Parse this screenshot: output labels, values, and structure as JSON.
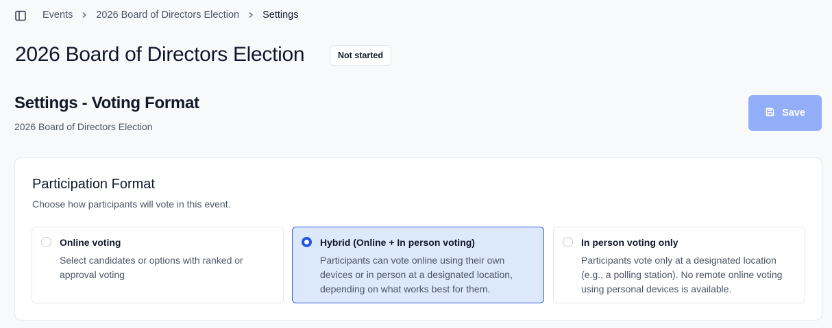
{
  "breadcrumb": {
    "items": [
      "Events",
      "2026 Board of Directors Election"
    ],
    "current": "Settings"
  },
  "page": {
    "title": "2026 Board of Directors Election",
    "status": "Not started"
  },
  "section": {
    "title": "Settings - Voting Format",
    "subtitle": "2026 Board of Directors Election",
    "save_label": "Save"
  },
  "participation": {
    "title": "Participation Format",
    "description": "Choose how participants will vote in this event.",
    "options": [
      {
        "label": "Online voting",
        "description": "Select candidates or options with ranked or approval voting",
        "selected": false
      },
      {
        "label": "Hybrid (Online + In person voting)",
        "description": "Participants can vote online using their own devices or in person at a designated location, depending on what works best for them.",
        "selected": true
      },
      {
        "label": "In person voting only",
        "description": "Participants vote only at a designated location (e.g., a polling station). No remote online voting using personal devices is available.",
        "selected": false
      }
    ]
  },
  "colors": {
    "accent": "#2056e6",
    "save_button": "#93aef8",
    "selected_bg": "#dce8fc"
  },
  "icons": {
    "sidebar_toggle": "sidebar-panel-icon",
    "separator": "chevron-right-icon",
    "save": "save-floppy-icon"
  }
}
